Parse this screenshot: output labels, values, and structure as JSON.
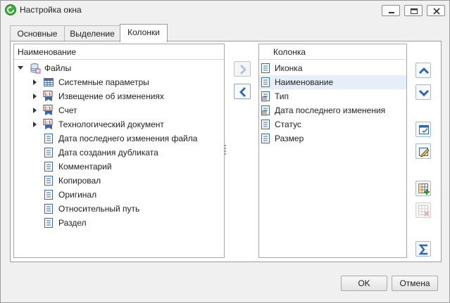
{
  "window": {
    "title": "Настройка окна"
  },
  "tabs": [
    {
      "label": "Основные"
    },
    {
      "label": "Выделение"
    },
    {
      "label": "Колонки"
    }
  ],
  "left_panel": {
    "header": "Наименование",
    "root": {
      "label": "Файлы"
    },
    "items": [
      {
        "label": "Системные параметры"
      },
      {
        "label": "Извещение об изменениях"
      },
      {
        "label": "Счет"
      },
      {
        "label": "Технологический документ"
      },
      {
        "label": "Дата последнего изменения файла"
      },
      {
        "label": "Дата создания дубликата"
      },
      {
        "label": "Комментарий"
      },
      {
        "label": "Копировал"
      },
      {
        "label": "Оригинал"
      },
      {
        "label": "Относительный путь"
      },
      {
        "label": "Раздел"
      }
    ]
  },
  "right_panel": {
    "header": "Колонка",
    "items": [
      {
        "label": "Иконка"
      },
      {
        "label": "Наименование"
      },
      {
        "label": "Тип"
      },
      {
        "label": "Дата последнего изменения"
      },
      {
        "label": "Статус"
      },
      {
        "label": "Размер"
      }
    ]
  },
  "buttons": {
    "ok": "OK",
    "cancel": "Отмена"
  },
  "colors": {
    "accent": "#2f66b3",
    "selection": "#e6eefa",
    "app_icon": "#3cae3a"
  }
}
